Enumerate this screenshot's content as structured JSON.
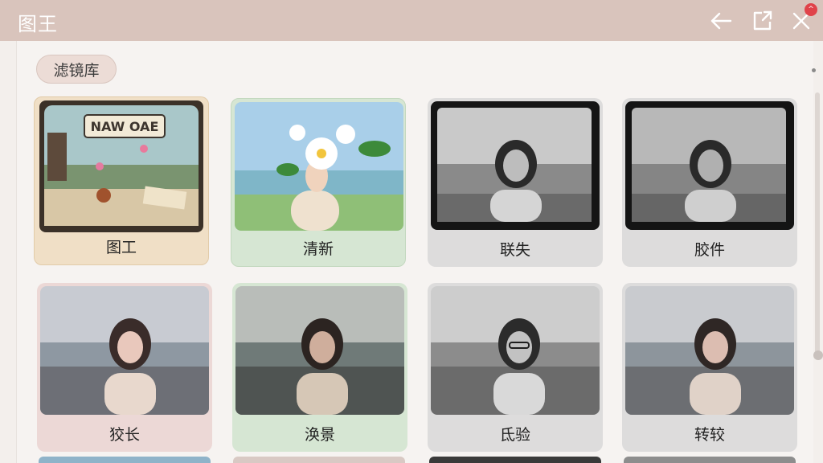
{
  "app": {
    "title": "图王"
  },
  "toolbar": {
    "back_icon": "arrow-left-icon",
    "share_icon": "share-icon",
    "close_icon": "close-icon",
    "badge": "^"
  },
  "section": {
    "chip_label": "滤镜库"
  },
  "filters": [
    {
      "label": "图工",
      "art_text": "NAW OAE"
    },
    {
      "label": "清新"
    },
    {
      "label": "联失"
    },
    {
      "label": "胶件"
    },
    {
      "label": "狡长"
    },
    {
      "label": "涣景"
    },
    {
      "label": "氐验"
    },
    {
      "label": "转较"
    }
  ],
  "colors": {
    "topbar": "#d9c4bc",
    "card_cream": "#f0dfc6",
    "card_green": "#d6e6d3",
    "card_gray": "#dddcdc",
    "card_pink": "#ecd8d6"
  }
}
